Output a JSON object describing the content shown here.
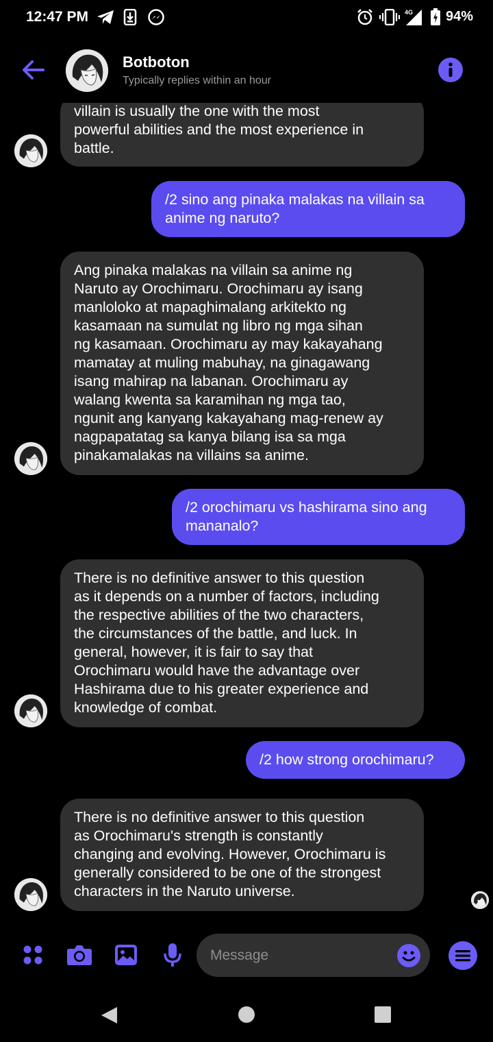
{
  "status_bar": {
    "time": "12:47 PM",
    "battery": "94%",
    "network": "4G",
    "icons": [
      "telegram-icon",
      "download-icon",
      "messenger-icon",
      "alarm-icon",
      "vibrate-icon",
      "signal-icon",
      "battery-icon"
    ]
  },
  "header": {
    "name": "Botboton",
    "subtitle": "Typically replies within an hour",
    "back_icon": "arrow-left-icon",
    "info_icon": "info-icon"
  },
  "messages": [
    {
      "from": "bot",
      "text": "villain is usually the one with the most\npowerful abilities and the most experience in\nbattle."
    },
    {
      "from": "me",
      "text": "/2 sino ang pinaka malakas na villain sa\nanime ng naruto?"
    },
    {
      "from": "bot",
      "text": "Ang pinaka malakas na villain sa anime ng\nNaruto ay Orochimaru. Orochimaru ay isang\nmanloloko at mapaghimalang arkitekto ng\nkasamaan na sumulat ng libro ng mga sihan\nng kasamaan. Orochimaru ay may kakayahang\nmamatay at muling mabuhay, na ginagawang\nisang mahirap na labanan. Orochimaru ay\nwalang kwenta sa karamihan ng mga tao,\nngunit ang kanyang kakayahang mag-renew ay\nnagpapatatag sa kanya bilang isa sa mga\npinakamalakas na villains sa anime."
    },
    {
      "from": "me",
      "text": "/2 orochimaru vs hashirama sino ang\nmananalo?"
    },
    {
      "from": "bot",
      "text": "There is no definitive answer to this question\nas it depends on a number of factors, including\nthe respective abilities of the two characters,\nthe circumstances of the battle, and luck. In\ngeneral, however, it is fair to say that\nOrochimaru would have the advantage over\nHashirama due to his greater experience and\nknowledge of combat."
    },
    {
      "from": "me",
      "text": "/2 how strong orochimaru?"
    },
    {
      "from": "bot",
      "text": "There is no definitive answer to this question\nas Orochimaru's strength is constantly\nchanging and evolving. However, Orochimaru is\ngenerally considered to be one of the strongest\ncharacters in the Naruto universe."
    }
  ],
  "composer": {
    "placeholder": "Message",
    "icons": [
      "apps-icon",
      "camera-icon",
      "image-icon",
      "microphone-icon",
      "emoji-icon",
      "menu-icon"
    ]
  },
  "colors": {
    "accent": "#6b5cf6",
    "outgoing_bubble": "#5b4cf0",
    "incoming_bubble": "#303030",
    "background": "#000000"
  }
}
